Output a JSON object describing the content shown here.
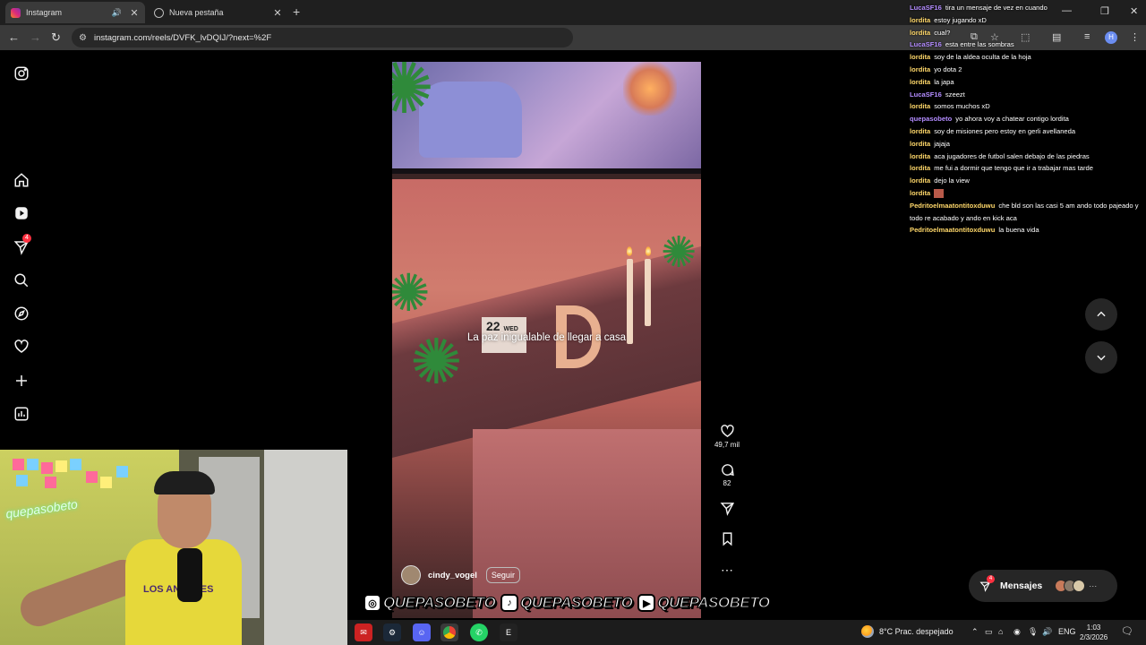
{
  "browser": {
    "tabs": [
      {
        "label": "Instagram",
        "active": true
      },
      {
        "label": "Nueva pestaña",
        "active": false
      }
    ],
    "url": "instagram.com/reels/DVFK_lvDQIJ/?next=%2F"
  },
  "sidebar": {
    "icons": [
      "instagram-logo-icon",
      "home-icon",
      "reels-icon",
      "messages-icon",
      "search-icon",
      "explore-icon",
      "notifications-icon",
      "create-icon",
      "dashboard-icon"
    ],
    "messages_badge": "4"
  },
  "reel": {
    "overlay_text": "La paz inigualable de llegar a casa",
    "date_card": "22",
    "date_card_day": "WED",
    "author": "cindy_vogel",
    "follow_label": "Seguir",
    "likes": "49,7 mil",
    "comments": "82"
  },
  "messages_pill": {
    "label": "Mensajes",
    "badge": "4"
  },
  "chat": [
    {
      "user": "LucaSF16",
      "color": "#b38cff",
      "text": "tira un mensaje de vez en cuando"
    },
    {
      "user": "lordita",
      "color": "#ffd86a",
      "text": "estoy jugando xD"
    },
    {
      "user": "lordita",
      "color": "#ffd86a",
      "text": "cual?"
    },
    {
      "user": "LucaSF16",
      "color": "#b38cff",
      "text": "esta entre las sombras"
    },
    {
      "user": "lordita",
      "color": "#ffd86a",
      "text": "soy de la aldea oculta de la hoja"
    },
    {
      "user": "lordita",
      "color": "#ffd86a",
      "text": "yo dota 2"
    },
    {
      "user": "lordita",
      "color": "#ffd86a",
      "text": "la japa"
    },
    {
      "user": "LucaSF16",
      "color": "#b38cff",
      "text": "szeezt"
    },
    {
      "user": "lordita",
      "color": "#ffd86a",
      "text": "somos muchos xD"
    },
    {
      "user": "quepasobeto",
      "color": "#b38cff",
      "text": "yo ahora voy a chatear contigo lordita"
    },
    {
      "user": "lordita",
      "color": "#ffd86a",
      "text": "soy de misiones pero estoy en gerli avellaneda"
    },
    {
      "user": "lordita",
      "color": "#ffd86a",
      "text": "jajaja"
    },
    {
      "user": "lordita",
      "color": "#ffd86a",
      "text": "aca jugadores de futbol salen debajo de las piedras"
    },
    {
      "user": "lordita",
      "color": "#ffd86a",
      "text": "me fui a dormir que tengo que ir a trabajar mas tarde"
    },
    {
      "user": "lordita",
      "color": "#ffd86a",
      "text": "dejo la view"
    },
    {
      "user": "lordita",
      "color": "#ffd86a",
      "text": ""
    },
    {
      "user": "Pedritoelmaatontitoxduwu",
      "color": "#ffd86a",
      "text": "che bld son las casi 5 am ando todo pajeado y todo re acabado y ando en kick aca"
    },
    {
      "user": "Pedritoelmaatontitoxduwu",
      "color": "#ffd86a",
      "text": "la buena vida"
    }
  ],
  "webcam": {
    "neon_text": "quepasobeto",
    "shirt_text": "LOS ANGELES"
  },
  "handles": [
    {
      "platform": "instagram-icon",
      "name": "QUEPASOBETO"
    },
    {
      "platform": "tiktok-icon",
      "name": "QUEPASOBETO"
    },
    {
      "platform": "youtube-icon",
      "name": "QUEPASOBETO"
    }
  ],
  "taskbar": {
    "weather": "8°C  Prac. despejado",
    "language": "ENG",
    "time": "1:03",
    "date": "2/3/2026"
  }
}
